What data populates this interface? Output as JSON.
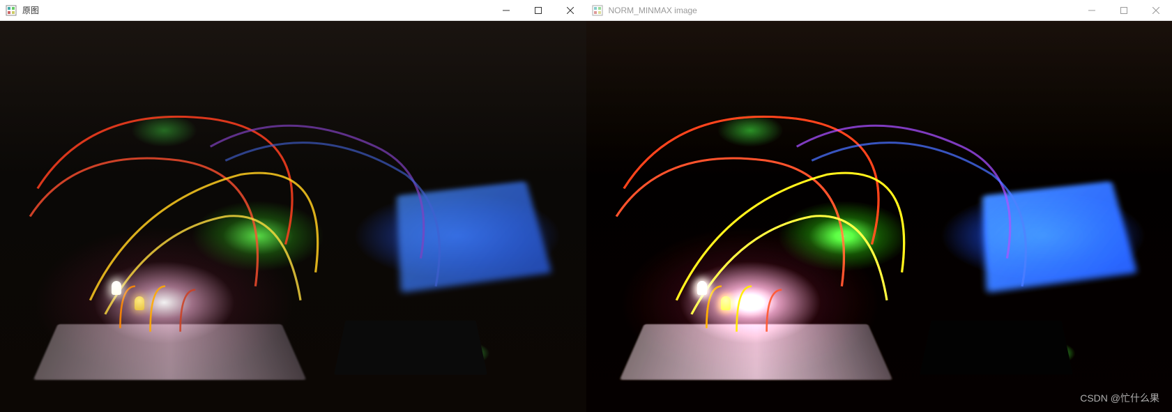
{
  "windows": {
    "left": {
      "title": "原图",
      "active": true
    },
    "right": {
      "title": "NORM_MINMAX image",
      "active": false
    }
  },
  "watermark": "CSDN @忙什么果"
}
